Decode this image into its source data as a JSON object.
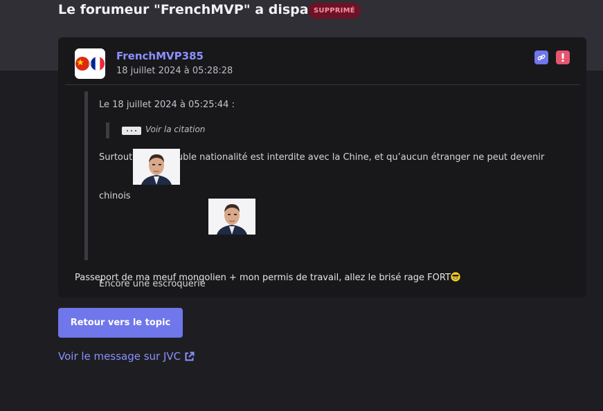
{
  "page": {
    "title": "Le forumeur \"FrenchMVP\" a disparu",
    "badge": "SUPPRIMÉ"
  },
  "post": {
    "avatar_icon": "china-france-flags-avatar",
    "username": "FrenchMVP385",
    "date": "18 juillet 2024 à 05:28:28",
    "actions": {
      "link_icon": "link-icon",
      "report_icon": "exclamation-icon",
      "link_color": "#6f77ea",
      "report_color": "#e6556f"
    },
    "quote": {
      "header": "Le 18 juillet 2024 à 05:25:44 :",
      "nested_label": "Voir la citation",
      "line1": "Surtout que la double nationalité est interdite avec la Chine, et qu’aucun étranger ne peut devenir",
      "line2": "chinois",
      "line3": "Encore une escroquerie",
      "sticker_icon": "person-portrait-sticker"
    },
    "body": "Passeport de ma meuf mongolien + mon permis de travail, allez le brisé rage FORT",
    "emoji_icon": "grinning-sunglasses-emoji"
  },
  "actions": {
    "back_button": "Retour vers le topic",
    "jvc_link": "Voir le message sur JVC",
    "external_icon": "external-link-icon"
  },
  "colors": {
    "accent": "#6f77ea",
    "username": "#8a91ff",
    "badge_bg": "#6a1426",
    "badge_text": "#ff8fa6"
  }
}
